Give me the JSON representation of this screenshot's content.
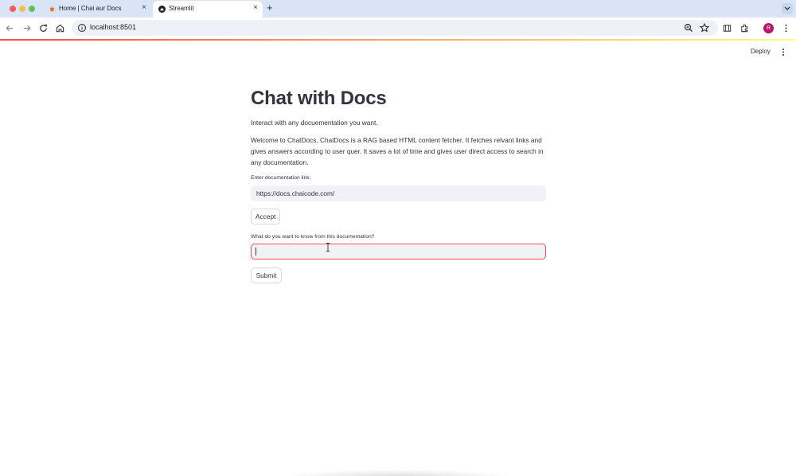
{
  "browser": {
    "tabs": [
      {
        "title": "Home | Chai aur Docs",
        "active": false,
        "favicon": "chai-favicon-icon"
      },
      {
        "title": "Streamlit",
        "active": true,
        "favicon": "streamlit-favicon-icon"
      }
    ],
    "new_tab_label": "+",
    "close_label": "×",
    "url": "localhost:8501",
    "profile_initial": "R"
  },
  "app": {
    "deploy_label": "Deploy",
    "title": "Chat with Docs",
    "intro": "Interact with any docuementation you want.",
    "description": "Welcome to ChatDocs. ChatDocs is a RAG based HTML content fetcher. It fetches relvant links and gives answers according to user quer. It saves a lot of time and gives user direct access to search in any documentation.",
    "link_input": {
      "label": "Enter documentation link:",
      "value": "https://docs.chaicode.com/"
    },
    "accept_label": "Accept",
    "question_input": {
      "label": "What do you want to know from this documentation?",
      "value": ""
    },
    "submit_label": "Submit"
  },
  "colors": {
    "primary": "#ff4b4b",
    "text": "#31333f",
    "input_bg": "#f0f2f6",
    "tabstrip_bg": "#d9e4f7"
  }
}
